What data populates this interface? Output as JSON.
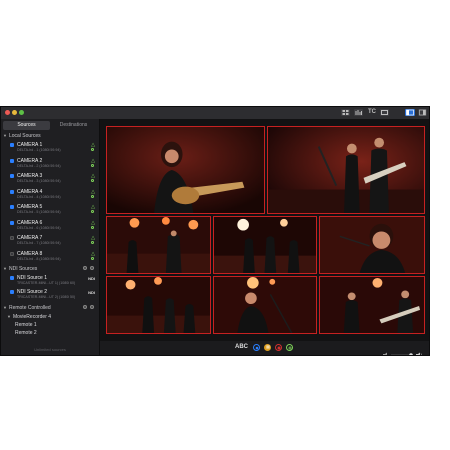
{
  "sidebar": {
    "tabs": [
      "Sources",
      "Destinations"
    ],
    "local_header": "Local Sources",
    "cameras": [
      {
        "name": "CAMERA 1",
        "sub": "DELTA-hd - 1 (1080i 59.94)",
        "checked": true
      },
      {
        "name": "CAMERA 2",
        "sub": "DELTA-hd - 2 (1080i 59.94)",
        "checked": true
      },
      {
        "name": "CAMERA 3",
        "sub": "DELTA-hd - 3 (1080i 59.94)",
        "checked": true
      },
      {
        "name": "CAMERA 4",
        "sub": "DELTA-hd - 4 (1080i 59.94)",
        "checked": true
      },
      {
        "name": "CAMERA 5",
        "sub": "DELTA-hd - 5 (1080i 59.94)",
        "checked": true
      },
      {
        "name": "CAMERA 6",
        "sub": "DELTA-hd - 6 (1080i 59.94)",
        "checked": true
      },
      {
        "name": "CAMERA 7",
        "sub": "DELTA-hd - 7 (1080i 59.94)",
        "checked": false
      },
      {
        "name": "CAMERA 8",
        "sub": "DELTA-hd - 8 (1080i 59.94)",
        "checked": false
      }
    ],
    "ndi_header": "NDI Sources",
    "ndi": [
      {
        "name": "NDI Source 1",
        "sub": "TRICASTER-MINI...UT 1) (1080i 60)",
        "badge": "NDI"
      },
      {
        "name": "NDI Source 2",
        "sub": "TRICASTER-MINI...UT 2) (1080i 50)",
        "badge": "NDI"
      }
    ],
    "remote_header": "Remote Controlled",
    "recorder": "MovieRecorder 4",
    "remotes": [
      "Remote 1",
      "Remote 2"
    ],
    "limited": "Unlimited sources"
  },
  "toolbar": {
    "tc_label": "TC"
  },
  "bottom": {
    "abc": "ABC"
  },
  "colors": {
    "accent": "#2a7fff",
    "tile_border": "#c62121",
    "ok": "#7fd45a"
  },
  "icons": [
    "grid-view-icon",
    "audio-meter-icon",
    "timecode-icon",
    "record-icon",
    "sidebar-toggle-icon",
    "layout-icon",
    "volume-icon"
  ]
}
